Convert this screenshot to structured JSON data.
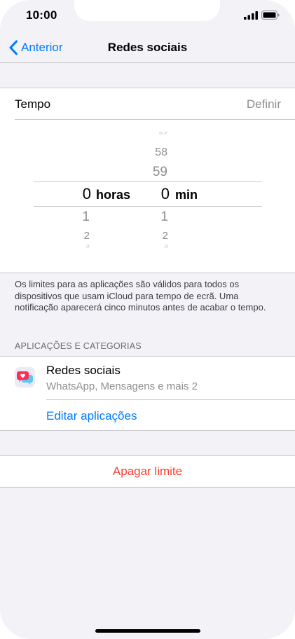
{
  "status_bar": {
    "time": "10:00",
    "signal_icon": "signal-bars-icon",
    "battery_icon": "battery-icon"
  },
  "nav": {
    "back_label": "Anterior",
    "title": "Redes sociais",
    "back_icon": "chevron-left-icon"
  },
  "time_section": {
    "label": "Tempo",
    "action": "Definir"
  },
  "picker": {
    "hours": {
      "above": [
        "",
        "",
        ""
      ],
      "selected": "0",
      "unit": "horas",
      "below": [
        "1",
        "2",
        "3"
      ]
    },
    "minutes": {
      "above": [
        "57",
        "58",
        "59"
      ],
      "selected": "0",
      "unit": "min",
      "below": [
        "1",
        "2",
        "3"
      ]
    }
  },
  "footer_note": "Os limites para as aplicações são válidos para todos os dispositivos que usam iCloud para tempo de ecrã. Uma notificação aparecerá cinco minutos antes de acabar o tempo.",
  "apps_section": {
    "header": "APLICAÇÕES E CATEGORIAS",
    "app_name": "Redes sociais",
    "app_subtitle": "WhatsApp, Mensagens e mais 2",
    "edit_label": "Editar aplicações",
    "app_icon": "social-chat-bubbles-icon"
  },
  "delete_label": "Apagar limite",
  "colors": {
    "accent": "#007aff",
    "destructive": "#ff3b30",
    "secondary_text": "#8e8e93",
    "background": "#f2f2f7"
  }
}
